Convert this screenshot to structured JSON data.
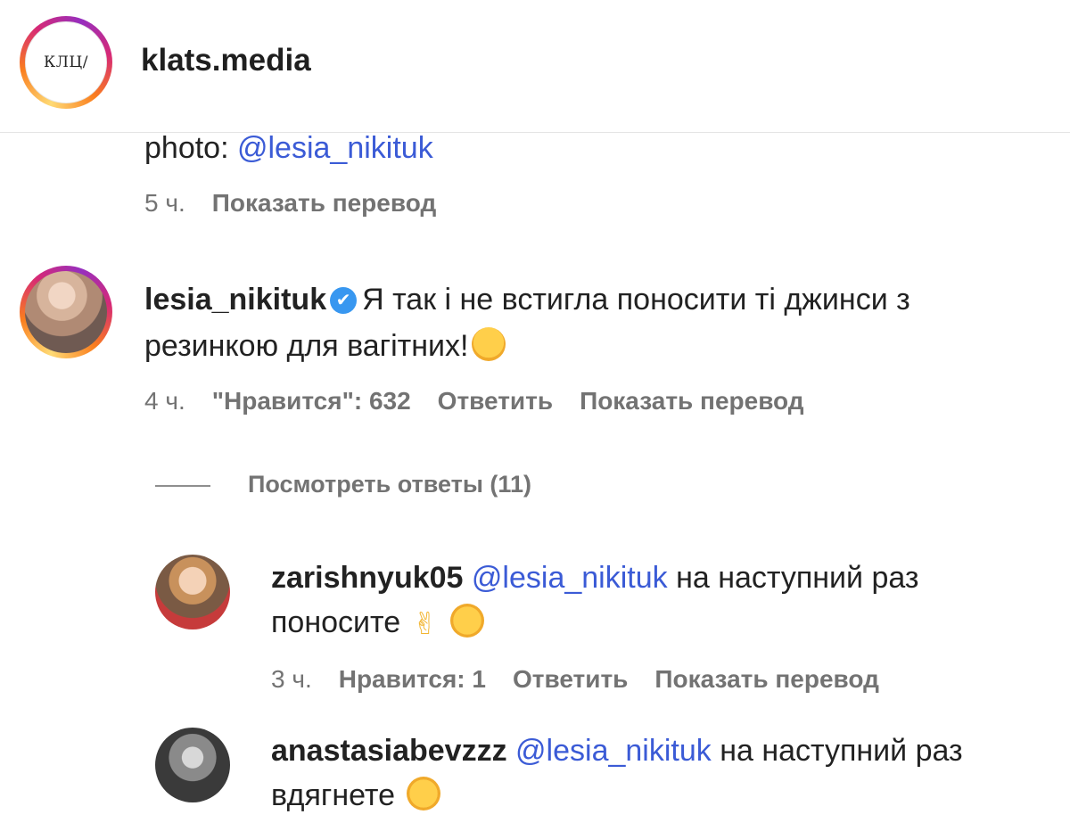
{
  "header": {
    "account_name": "klats.media",
    "logo_text": "КЛЦ/"
  },
  "caption": {
    "text_prefix": "photo: ",
    "mention": "@lesia_nikituk",
    "time": "5 ч.",
    "translate": "Показать перевод"
  },
  "comment": {
    "username": "lesia_nikituk",
    "verified_icon": "✔",
    "text_line1": "Я так і не встигла поносити ті джинси з",
    "text_line2": "резинкою для вагітних!",
    "emoji": "hot-face-emoji",
    "time": "4 ч.",
    "likes": "\"Нравится\": 632",
    "reply": "Ответить",
    "translate": "Показать перевод",
    "view_replies": "Посмотреть ответы (11)"
  },
  "replies": [
    {
      "username": "zarishnyuk05",
      "mention": "@lesia_nikituk",
      "text_line1_rest": " на наступний раз",
      "text_line2": "поносите",
      "emojis": [
        "ok-hand-emoji",
        "star-struck-emoji"
      ],
      "time": "3 ч.",
      "likes": "Нравится: 1",
      "reply": "Ответить",
      "translate": "Показать перевод"
    },
    {
      "username": "anastasiabevzzz",
      "mention": "@lesia_nikituk",
      "text_line1_rest": " на наступний раз",
      "text_line2": "вдягнете",
      "emojis": [
        "tears-of-joy-emoji"
      ]
    }
  ],
  "colors": {
    "mention": "#3b5bd6",
    "meta": "#737373",
    "verified": "#3897f0"
  }
}
